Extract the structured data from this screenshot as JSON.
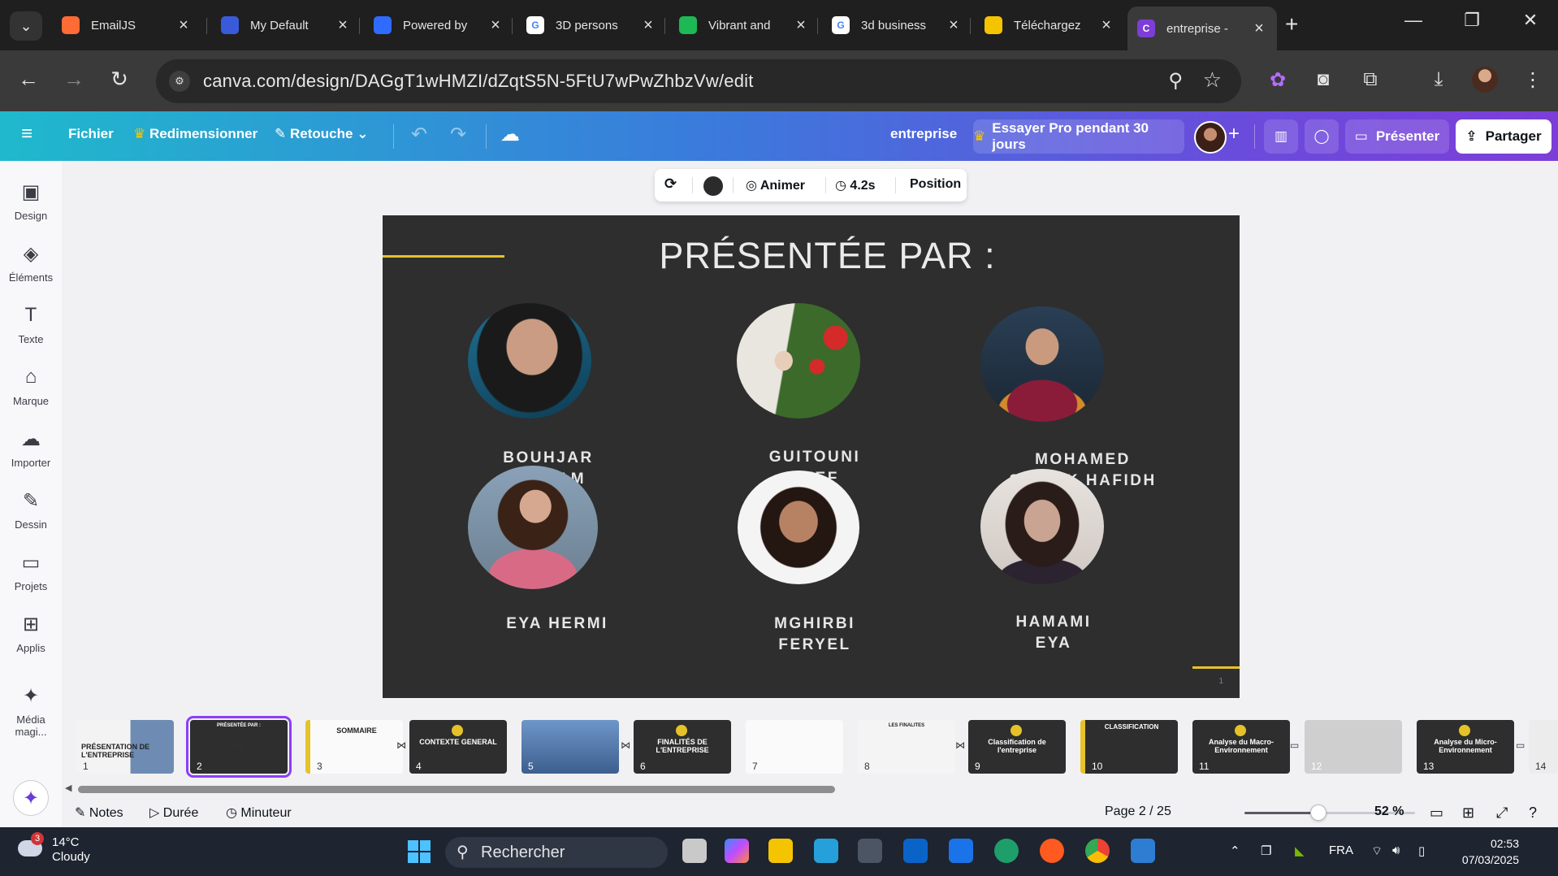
{
  "browser": {
    "tabs": [
      {
        "title": "EmailJS",
        "fav": "#ff6b35"
      },
      {
        "title": "My Default",
        "fav": "#3a5bd9"
      },
      {
        "title": "Powered by",
        "fav": "#2f6bff"
      },
      {
        "title": "3D persons",
        "fav": "#ffffff"
      },
      {
        "title": "Vibrant and",
        "fav": "#1db954"
      },
      {
        "title": "3d business",
        "fav": "#ffffff"
      },
      {
        "title": "Téléchargez",
        "fav": "#f5c400"
      },
      {
        "title": "entreprise -",
        "fav": "#7d3ed8"
      }
    ],
    "url": "canva.com/design/DAGgT1wHMZI/dZqtS5N-5FtU7wPwZhbzVw/edit"
  },
  "toolbar": {
    "menu_label": "≡",
    "file": "Fichier",
    "resize": "Redimensionner",
    "retouch": "Retouche",
    "doc_title": "entreprise",
    "try_pro": "Essayer Pro pendant 30 jours",
    "present": "Présenter",
    "share": "Partager"
  },
  "sidebar": {
    "items": [
      {
        "label": "Design",
        "icon": "▣"
      },
      {
        "label": "Éléments",
        "icon": "◈"
      },
      {
        "label": "Texte",
        "icon": "T"
      },
      {
        "label": "Marque",
        "icon": "⌂"
      },
      {
        "label": "Importer",
        "icon": "☁"
      },
      {
        "label": "Dessin",
        "icon": "✎"
      },
      {
        "label": "Projets",
        "icon": "▭"
      },
      {
        "label": "Applis",
        "icon": "⊞"
      },
      {
        "label": "Média magi...",
        "icon": "✦"
      }
    ]
  },
  "float_toolbar": {
    "animate": "Animer",
    "duration": "4.2s",
    "position": "Position"
  },
  "slide": {
    "title": "PRÉSENTÉE PAR :",
    "page_number": "1",
    "members": [
      {
        "line1": "BOUHJAR",
        "line2": "MERIAM"
      },
      {
        "line1": "GUITOUNI",
        "line2": "AFEF"
      },
      {
        "line1": "MOHAMED",
        "line2": "SEDDIK HAFIDH"
      },
      {
        "line1": "EYA HERMI",
        "line2": ""
      },
      {
        "line1": "MGHIRBI",
        "line2": "FERYEL"
      },
      {
        "line1": "HAMAMI",
        "line2": "EYA"
      }
    ]
  },
  "pages": [
    {
      "n": "1",
      "label": "PRÉSENTATION DE L'ENTREPRISE"
    },
    {
      "n": "2",
      "label": "PRÉSENTÉE PAR :"
    },
    {
      "n": "3",
      "label": "SOMMAIRE"
    },
    {
      "n": "4",
      "label": "CONTEXTE GENERAL"
    },
    {
      "n": "5",
      "label": ""
    },
    {
      "n": "6",
      "label": "FINALITÉS DE L'ENTREPRISE"
    },
    {
      "n": "7",
      "label": ""
    },
    {
      "n": "8",
      "label": "LES FINALITES"
    },
    {
      "n": "9",
      "label": "Classification de l'entreprise"
    },
    {
      "n": "10",
      "label": "CLASSIFICATION"
    },
    {
      "n": "11",
      "label": "Analyse du Macro-Environnement"
    },
    {
      "n": "12",
      "label": ""
    },
    {
      "n": "13",
      "label": "Analyse du Micro-Environnement"
    },
    {
      "n": "14",
      "label": ""
    }
  ],
  "status": {
    "notes": "Notes",
    "duration": "Durée",
    "timer": "Minuteur",
    "page": "Page 2 / 25",
    "zoom": "52 %",
    "zoom_level": 0.52
  },
  "taskbar": {
    "temp": "14°C",
    "weather": "Cloudy",
    "weather_badge": "3",
    "search": "Rechercher",
    "lang": "FRA",
    "time": "02:53",
    "date": "07/03/2025"
  }
}
